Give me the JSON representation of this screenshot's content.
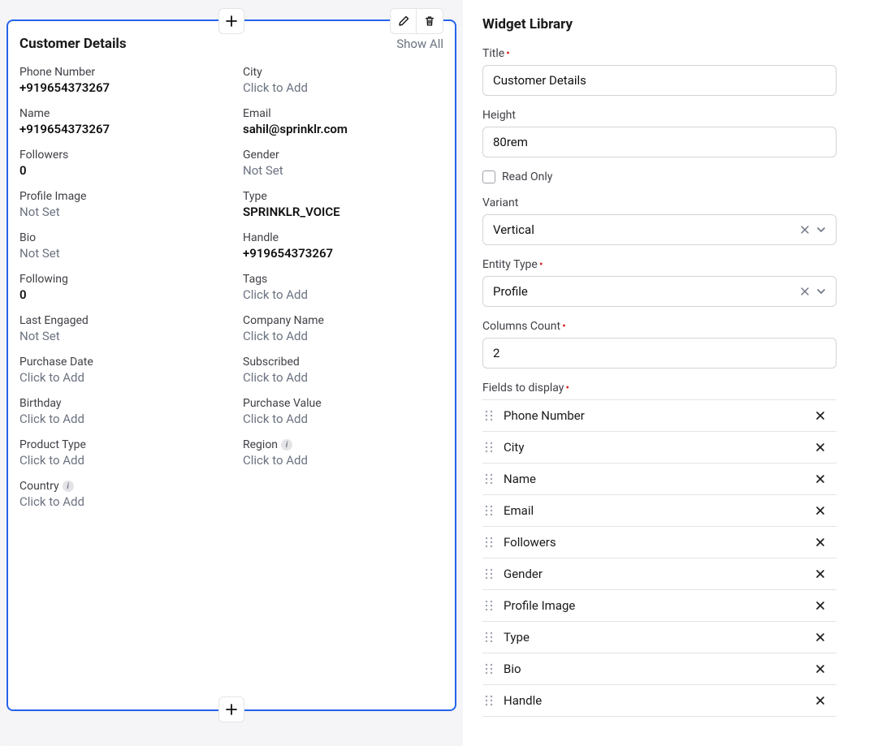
{
  "preview": {
    "title": "Customer Details",
    "show_all": "Show All",
    "click_to_add": "Click to Add",
    "not_set": "Not Set",
    "left_fields": [
      {
        "label": "Phone Number",
        "value": "+919654373267",
        "state": "value"
      },
      {
        "label": "Name",
        "value": "+919654373267",
        "state": "value"
      },
      {
        "label": "Followers",
        "value": "0",
        "state": "value"
      },
      {
        "label": "Profile Image",
        "value": "Not Set",
        "state": "notset"
      },
      {
        "label": "Bio",
        "value": "Not Set",
        "state": "notset"
      },
      {
        "label": "Following",
        "value": "0",
        "state": "value"
      },
      {
        "label": "Last Engaged",
        "value": "Not Set",
        "state": "notset"
      },
      {
        "label": "Purchase Date",
        "value": "Click to Add",
        "state": "add"
      },
      {
        "label": "Birthday",
        "value": "Click to Add",
        "state": "add"
      },
      {
        "label": "Product Type",
        "value": "Click to Add",
        "state": "add"
      },
      {
        "label": "Country",
        "value": "Click to Add",
        "state": "add",
        "info": true
      }
    ],
    "right_fields": [
      {
        "label": "City",
        "value": "Click to Add",
        "state": "add"
      },
      {
        "label": "Email",
        "value": "sahil@sprinklr.com",
        "state": "value"
      },
      {
        "label": "Gender",
        "value": "Not Set",
        "state": "notset"
      },
      {
        "label": "Type",
        "value": "SPRINKLR_VOICE",
        "state": "value"
      },
      {
        "label": "Handle",
        "value": "+919654373267",
        "state": "value"
      },
      {
        "label": "Tags",
        "value": "Click to Add",
        "state": "add"
      },
      {
        "label": "Company Name",
        "value": "Click to Add",
        "state": "add"
      },
      {
        "label": "Subscribed",
        "value": "Click to Add",
        "state": "add"
      },
      {
        "label": "Purchase Value",
        "value": "Click to Add",
        "state": "add"
      },
      {
        "label": "Region",
        "value": "Click to Add",
        "state": "add",
        "info": true
      }
    ]
  },
  "config": {
    "panel_title": "Widget Library",
    "title_label": "Title",
    "title_value": "Customer Details",
    "height_label": "Height",
    "height_value": "80rem",
    "readonly_label": "Read Only",
    "variant_label": "Variant",
    "variant_value": "Vertical",
    "entity_type_label": "Entity Type",
    "entity_type_value": "Profile",
    "columns_label": "Columns Count",
    "columns_value": "2",
    "fields_label": "Fields to display",
    "fields": [
      "Phone Number",
      "City",
      "Name",
      "Email",
      "Followers",
      "Gender",
      "Profile Image",
      "Type",
      "Bio",
      "Handle"
    ]
  }
}
